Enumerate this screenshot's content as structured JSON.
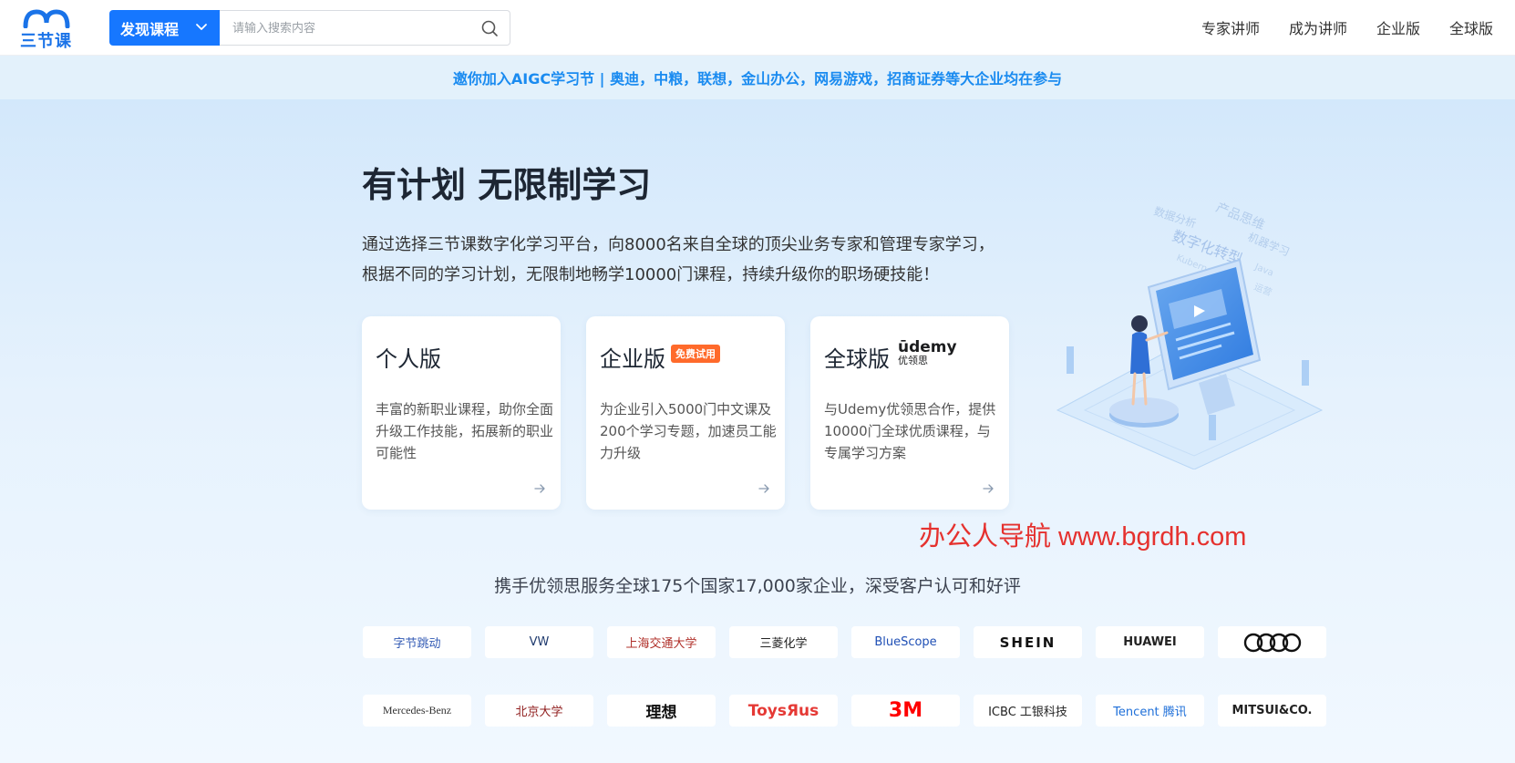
{
  "header": {
    "logo_text": "三节课",
    "discover_label": "发现课程",
    "search_placeholder": "请输入搜索内容",
    "nav": [
      "专家讲师",
      "成为讲师",
      "企业版",
      "全球版"
    ]
  },
  "announcement": "邀你加入AIGC学习节 | 奥迪，中粮，联想，金山办公，网易游戏，招商证券等大企业均在参与",
  "hero": {
    "title": "有计划 无限制学习",
    "desc_line1": "通过选择三节课数字化学习平台，向8000名来自全球的顶尖业务专家和管理专家学习，",
    "desc_line2": "根据不同的学习计划，无限制地畅学10000门课程，持续升级你的职场硬技能！"
  },
  "cards": [
    {
      "title": "个人版",
      "desc": "丰富的新职业课程，助你全面升级工作技能，拓展新的职业可能性"
    },
    {
      "title": "企业版",
      "badge": "免费试用",
      "desc": "为企业引入5000门中文课及200个学习专题，加速员工能力升级"
    },
    {
      "title": "全球版",
      "brand_line1": "ūdemy",
      "brand_line2": "优领思",
      "desc": "与Udemy优领思合作，提供10000门全球优质课程，与专属学习方案"
    }
  ],
  "illustration_words": [
    "数据分析",
    "产品思维",
    "数字化转型",
    "机器学习",
    "Kubernetes",
    "Java",
    "运营"
  ],
  "watermark": "办公人导航 www.bgrdh.com",
  "partners_title": "携手优领思服务全球175个国家17,000家企业，深受客户认可和好评",
  "partners_row1": [
    {
      "name": "ByteDance",
      "label": "字节跳动",
      "color": "#325ab4"
    },
    {
      "name": "Volkswagen",
      "label": "VW",
      "color": "#1f3a6e"
    },
    {
      "name": "Shanghai Jiao Tong University",
      "label": "上海交通大学",
      "color": "#b0302a"
    },
    {
      "name": "Mitsubishi Chemical",
      "label": "三菱化学",
      "color": "#222222"
    },
    {
      "name": "BlueScope",
      "label": "BlueScope",
      "color": "#1f4fb5"
    },
    {
      "name": "SHEIN",
      "label": "SHEIN",
      "color": "#111111"
    },
    {
      "name": "Huawei",
      "label": "HUAWEI",
      "color": "#222222"
    },
    {
      "name": "Audi",
      "label": "",
      "color": "#111111"
    }
  ],
  "partners_row2": [
    {
      "name": "Mercedes-Benz",
      "label": "Mercedes-Benz",
      "color": "#333333"
    },
    {
      "name": "Peking University",
      "label": "北京大学",
      "color": "#8f1c1c"
    },
    {
      "name": "Li Auto",
      "label": "理想",
      "color": "#111111"
    },
    {
      "name": "Toys R Us",
      "label": "ToysЯus",
      "color": "#e53935"
    },
    {
      "name": "3M",
      "label": "3M",
      "color": "#ff0000"
    },
    {
      "name": "ICBC",
      "label": "ICBC 工银科技",
      "color": "#222222"
    },
    {
      "name": "Tencent",
      "label": "Tencent 腾讯",
      "color": "#1e6fd9"
    },
    {
      "name": "Mitsui & Co.",
      "label": "MITSUI&CO.",
      "color": "#222222"
    }
  ],
  "colors": {
    "primary": "#1677ff",
    "announce_text": "#1a8bf0",
    "badge": "#ff6a2b",
    "watermark": "#e5312e"
  }
}
